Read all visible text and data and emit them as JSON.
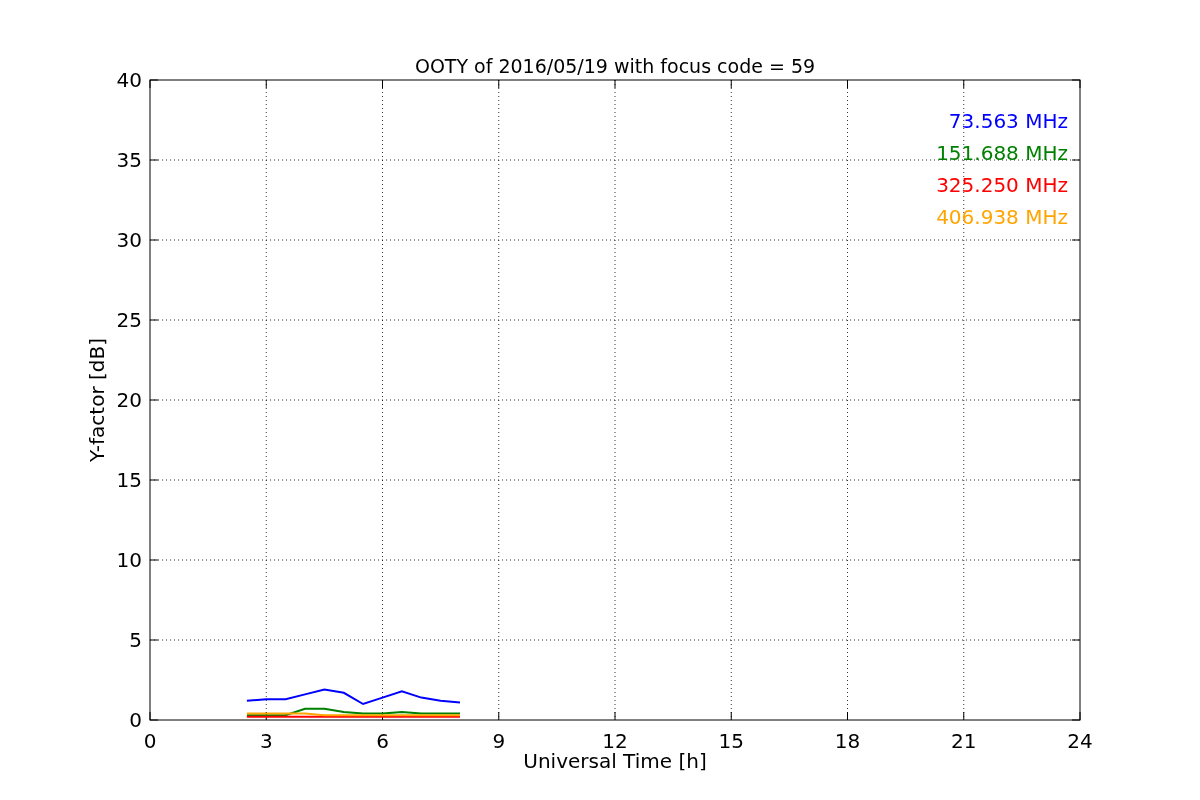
{
  "chart_data": {
    "type": "line",
    "title": "OOTY of 2016/05/19 with focus code = 59",
    "xlabel": "Universal Time [h]",
    "ylabel": "Y-factor [dB]",
    "x": [
      2.5,
      3,
      3.5,
      4,
      4.5,
      5,
      5.5,
      6,
      6.5,
      7,
      7.5,
      8
    ],
    "xlim": [
      0,
      24
    ],
    "ylim": [
      0,
      40
    ],
    "xticks": [
      0,
      3,
      6,
      9,
      12,
      15,
      18,
      21,
      24
    ],
    "yticks": [
      0,
      5,
      10,
      15,
      20,
      25,
      30,
      35,
      40
    ],
    "grid": true,
    "series": [
      {
        "name": "73.563 MHz",
        "color": "#0000ff",
        "values": [
          1.2,
          1.3,
          1.3,
          1.6,
          1.9,
          1.7,
          1.0,
          1.4,
          1.8,
          1.4,
          1.2,
          1.1
        ]
      },
      {
        "name": "151.688 MHz",
        "color": "#008000",
        "values": [
          0.3,
          0.3,
          0.3,
          0.7,
          0.7,
          0.5,
          0.4,
          0.4,
          0.5,
          0.4,
          0.4,
          0.4
        ]
      },
      {
        "name": "325.250 MHz",
        "color": "#ff0000",
        "values": [
          0.2,
          0.2,
          0.2,
          0.2,
          0.2,
          0.2,
          0.2,
          0.2,
          0.2,
          0.2,
          0.2,
          0.2
        ]
      },
      {
        "name": "406.938 MHz",
        "color": "#ffa500",
        "values": [
          0.4,
          0.4,
          0.4,
          0.4,
          0.3,
          0.3,
          0.3,
          0.3,
          0.3,
          0.3,
          0.3,
          0.3
        ]
      }
    ]
  }
}
